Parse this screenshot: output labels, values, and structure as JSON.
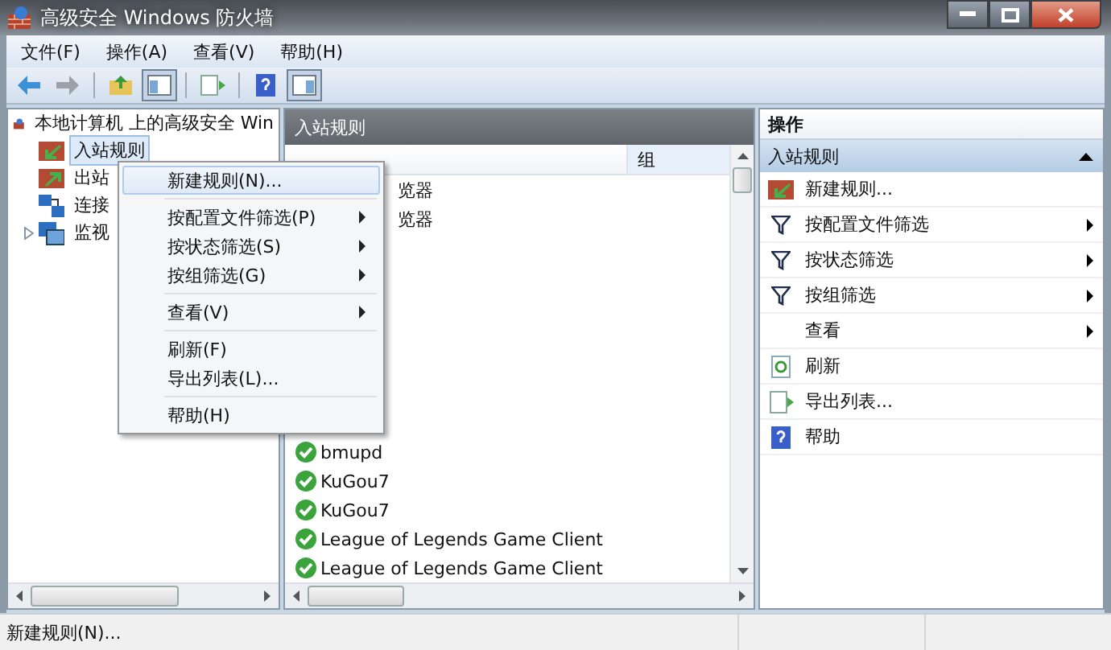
{
  "window": {
    "title": "高级安全 Windows 防火墙"
  },
  "menu_bar": [
    "文件(F)",
    "操作(A)",
    "查看(V)",
    "帮助(H)"
  ],
  "toolbar": [
    {
      "kind": "back",
      "pressed": false
    },
    {
      "kind": "forward",
      "pressed": false
    },
    {
      "kind": "separator"
    },
    {
      "kind": "up",
      "pressed": false
    },
    {
      "kind": "tree",
      "pressed": true
    },
    {
      "kind": "separator"
    },
    {
      "kind": "export",
      "pressed": false
    },
    {
      "kind": "separator"
    },
    {
      "kind": "help",
      "pressed": false
    },
    {
      "kind": "pane",
      "pressed": true
    }
  ],
  "tree": {
    "label": "本地计算机 上的高级安全 Win",
    "children": [
      {
        "label": "入站规则",
        "kind": "inbound",
        "selected": true
      },
      {
        "label": "出站",
        "kind": "outbound",
        "selected": false
      },
      {
        "label": "连接",
        "kind": "connection",
        "selected": false
      },
      {
        "label": "监视",
        "kind": "monitor",
        "selected": false,
        "expandable": true
      }
    ]
  },
  "list": {
    "title": "入站规则",
    "columns": [
      {
        "label": "组"
      }
    ],
    "rows": [
      {
        "kind": "partial",
        "name": "览器"
      },
      {
        "kind": "partial",
        "name": "览器"
      },
      {
        "kind": "rule",
        "name": "bmupd",
        "enabled": true
      },
      {
        "kind": "rule",
        "name": "KuGou7",
        "enabled": true
      },
      {
        "kind": "rule",
        "name": "KuGou7",
        "enabled": true
      },
      {
        "kind": "rule",
        "name": "League of Legends Game Client",
        "enabled": true
      },
      {
        "kind": "rule",
        "name": "League of Legends Game Client",
        "enabled": true
      }
    ]
  },
  "context_menu": [
    {
      "kind": "item",
      "label": "新建规则(N)...",
      "selected": true,
      "submenu": false
    },
    {
      "kind": "separator"
    },
    {
      "kind": "item",
      "label": "按配置文件筛选(P)",
      "selected": false,
      "submenu": true
    },
    {
      "kind": "item",
      "label": "按状态筛选(S)",
      "selected": false,
      "submenu": true
    },
    {
      "kind": "item",
      "label": "按组筛选(G)",
      "selected": false,
      "submenu": true
    },
    {
      "kind": "separator"
    },
    {
      "kind": "item",
      "label": "查看(V)",
      "selected": false,
      "submenu": true
    },
    {
      "kind": "separator"
    },
    {
      "kind": "item",
      "label": "刷新(F)",
      "selected": false,
      "submenu": false
    },
    {
      "kind": "item",
      "label": "导出列表(L)...",
      "selected": false,
      "submenu": false
    },
    {
      "kind": "separator"
    },
    {
      "kind": "item",
      "label": "帮助(H)",
      "selected": false,
      "submenu": false
    }
  ],
  "actions": {
    "title": "操作",
    "section": {
      "label": "入站规则",
      "expanded": true
    },
    "items": [
      {
        "kind": "new-rule",
        "label": "新建规则...",
        "submenu": false
      },
      {
        "kind": "filter",
        "label": "按配置文件筛选",
        "submenu": true
      },
      {
        "kind": "filter",
        "label": "按状态筛选",
        "submenu": true
      },
      {
        "kind": "filter",
        "label": "按组筛选",
        "submenu": true
      },
      {
        "kind": "none",
        "label": "查看",
        "submenu": true
      },
      {
        "kind": "refresh",
        "label": "刷新",
        "submenu": false
      },
      {
        "kind": "export",
        "label": "导出列表...",
        "submenu": false
      },
      {
        "kind": "help",
        "label": "帮助",
        "submenu": false
      }
    ]
  },
  "status_bar": "新建规则(N)..."
}
